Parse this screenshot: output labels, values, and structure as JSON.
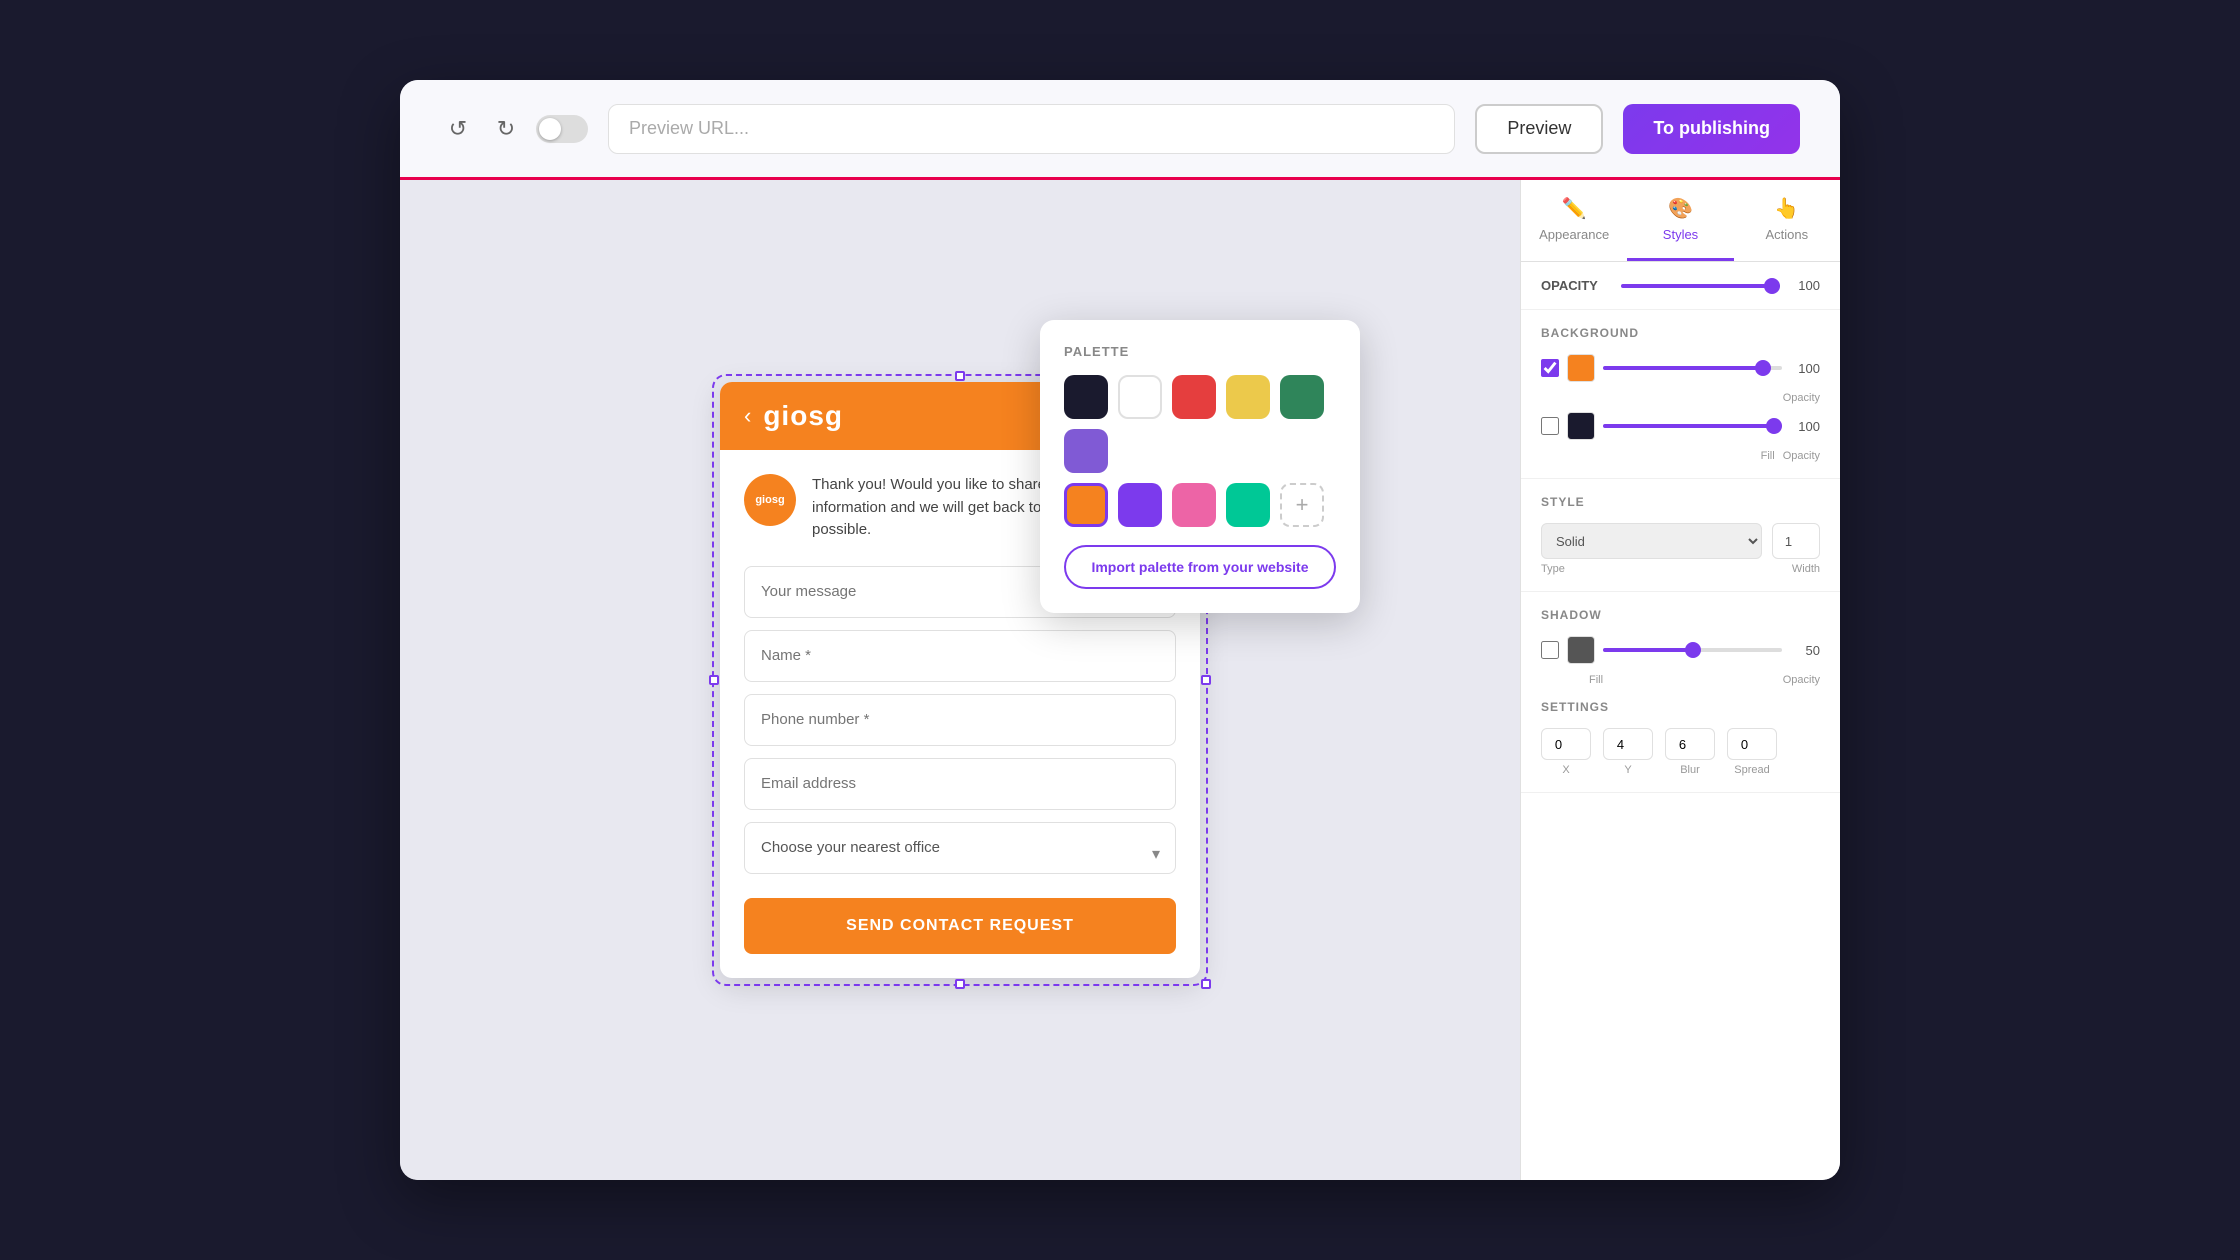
{
  "topbar": {
    "url_placeholder": "Preview URL...",
    "preview_label": "Preview",
    "publish_label": "To publishing"
  },
  "tabs": {
    "appearance": "Appearance",
    "styles": "Styles",
    "actions": "Actions"
  },
  "opacity_section": {
    "title": "OPACITY",
    "value": "100"
  },
  "background_section": {
    "title": "BACKGROUND",
    "opacity_value": "100"
  },
  "style_section": {
    "title": "STYLE",
    "type_label": "Type",
    "width_label": "Width",
    "type_value": "Solid",
    "width_value": "1"
  },
  "shadow_section": {
    "title": "SHADOW",
    "opacity_value": "50",
    "fill_label": "Fill",
    "opacity_label": "Opacity",
    "settings_title": "SETTINGS",
    "x_value": "0",
    "y_value": "4",
    "blur_value": "6",
    "spread_value": "0",
    "x_label": "X",
    "y_label": "Y",
    "blur_label": "Blur",
    "spread_label": "Spread"
  },
  "palette": {
    "title": "PALETTE",
    "colors": [
      {
        "hex": "#1a1a2e",
        "name": "black"
      },
      {
        "hex": "#ffffff",
        "name": "white"
      },
      {
        "hex": "#e53e3e",
        "name": "red"
      },
      {
        "hex": "#ecc94b",
        "name": "yellow"
      },
      {
        "hex": "#2f855a",
        "name": "green"
      },
      {
        "hex": "#805ad5",
        "name": "purple"
      },
      {
        "hex": "#f5821f",
        "name": "orange",
        "selected": true
      },
      {
        "hex": "#7c3aed",
        "name": "violet"
      },
      {
        "hex": "#ed64a6",
        "name": "pink"
      },
      {
        "hex": "#00c896",
        "name": "teal"
      }
    ],
    "import_label": "Import palette from your website"
  },
  "widget": {
    "header": {
      "logo": "giosg",
      "back_icon": "‹",
      "close_icon": "×"
    },
    "greeting": "Thank you! Would you like to share your contact information and we will get back to you as soon as possible.",
    "fields": {
      "message_placeholder": "Your message",
      "name_placeholder": "Name *",
      "phone_placeholder": "Phone number *",
      "email_placeholder": "Email address",
      "office_placeholder": "Choose your nearest office"
    },
    "send_button": "SEND CONTACT REQUEST"
  }
}
